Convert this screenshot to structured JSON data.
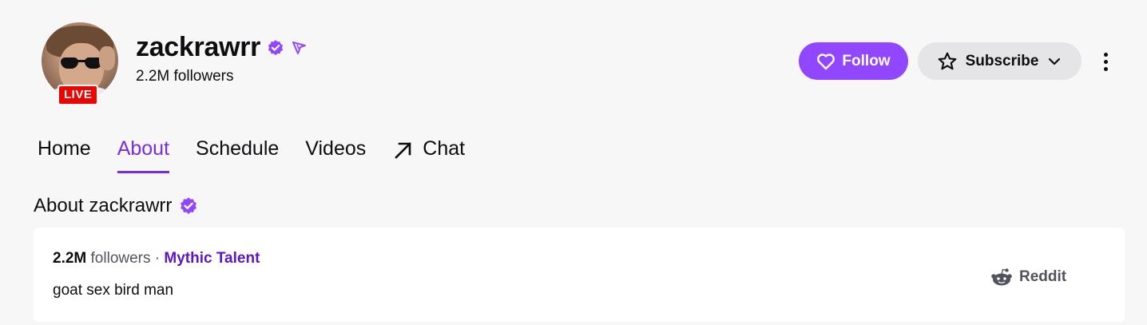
{
  "channel": {
    "name": "zackrawrr",
    "followers_text": "2.2M followers",
    "live_badge": "LIVE"
  },
  "actions": {
    "follow_label": "Follow",
    "subscribe_label": "Subscribe"
  },
  "tabs": [
    {
      "label": "Home",
      "active": false
    },
    {
      "label": "About",
      "active": true
    },
    {
      "label": "Schedule",
      "active": false
    },
    {
      "label": "Videos",
      "active": false
    },
    {
      "label": "Chat",
      "active": false,
      "external": true
    }
  ],
  "about": {
    "heading": "About zackrawrr",
    "followers_count": "2.2M",
    "followers_word": "followers",
    "separator": "·",
    "team": "Mythic Talent",
    "bio": "goat sex bird man",
    "social": [
      {
        "label": "Reddit",
        "icon": "reddit-icon"
      }
    ]
  },
  "colors": {
    "accent": "#9147ff",
    "accent_text": "#772ce8",
    "live": "#eb0400",
    "background": "#f7f7f8"
  }
}
